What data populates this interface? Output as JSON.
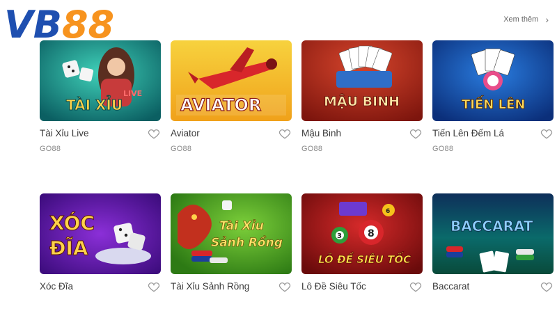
{
  "brand": {
    "logo_text": "VB88"
  },
  "header": {
    "see_more_label": "Xem thêm",
    "see_more_icon": "chevron-right-icon"
  },
  "games": [
    {
      "title": "Tài Xỉu Live",
      "provider": "GO88",
      "art_text": "TÀI XỈU",
      "art_badge": "LIVE"
    },
    {
      "title": "Aviator",
      "provider": "GO88",
      "art_text": "AVIATOR"
    },
    {
      "title": "Mậu Binh",
      "provider": "GO88",
      "art_text": "MẬU BINH"
    },
    {
      "title": "Tiến Lên Đếm Lá",
      "provider": "GO88",
      "art_text": "TIẾN LÊN"
    },
    {
      "title": "Xóc Đĩa",
      "provider": "",
      "art_text_1": "XÓC",
      "art_text_2": "ĐĨA"
    },
    {
      "title": "Tài Xỉu Sảnh Rồng",
      "provider": "",
      "art_text_1": "Tài Xỉu",
      "art_text_2": "Sảnh Rồng"
    },
    {
      "title": "Lô Đề Siêu Tốc",
      "provider": "",
      "art_text": "LÔ ĐỀ SIÊU TỐC",
      "ball_1": "3",
      "ball_2": "8",
      "ball_3": "6"
    },
    {
      "title": "Baccarat",
      "provider": "",
      "art_text": "BACCARAT"
    }
  ],
  "colors": {
    "logo_blue": "#1e4fb0",
    "logo_orange": "#f7931e",
    "heart_stroke": "#9a9a9a"
  }
}
